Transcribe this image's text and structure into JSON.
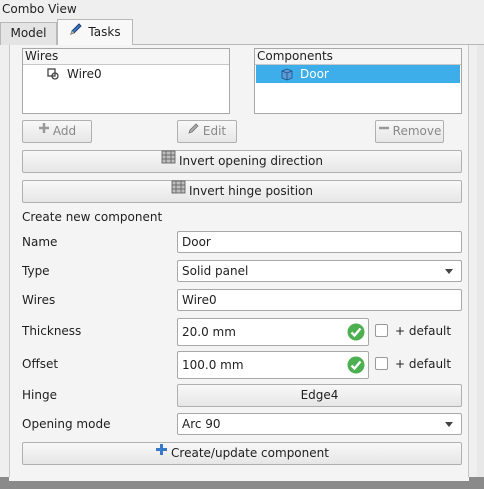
{
  "window": {
    "title": "Combo View"
  },
  "tabs": [
    {
      "label": "Model"
    },
    {
      "label": "Tasks"
    }
  ],
  "wires_list": {
    "header": "Wires",
    "items": [
      "Wire0"
    ]
  },
  "components_list": {
    "header": "Components",
    "items": [
      "Door"
    ],
    "selected": "Door"
  },
  "list_buttons": {
    "add": "Add",
    "edit": "Edit",
    "remove": "Remove"
  },
  "actions": {
    "invert_opening": "Invert opening direction",
    "invert_hinge": "Invert hinge position"
  },
  "form": {
    "section_title": "Create new component",
    "name_label": "Name",
    "name_value": "Door",
    "type_label": "Type",
    "type_value": "Solid panel",
    "wires_label": "Wires",
    "wires_value": "Wire0",
    "thickness_label": "Thickness",
    "thickness_value": "20.0 mm",
    "thickness_default_label": "+ default",
    "offset_label": "Offset",
    "offset_value": "100.0 mm",
    "offset_default_label": "+ default",
    "hinge_label": "Hinge",
    "hinge_value": "Edge4",
    "opening_label": "Opening mode",
    "opening_value": "Arc 90",
    "submit_label": "Create/update component"
  },
  "colors": {
    "selection": "#3daee9",
    "valid_check": "#4caf50",
    "add_icon": "#3a78c9"
  }
}
